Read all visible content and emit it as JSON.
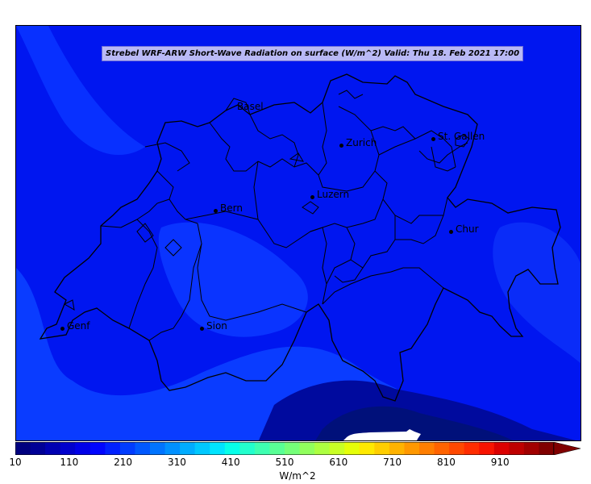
{
  "title": "Strebel WRF-ARW Short-Wave Radiation on surface (W/m^2)   Valid: Thu 18. Feb 2021 17:00",
  "units": "W/m^2",
  "colors": {
    "background_field": "#0016f0",
    "light_field": "#0a3cff",
    "dark_field": "#00108c",
    "border": "#000000",
    "title_bg": "#b9b9f6"
  },
  "cities": [
    {
      "name": "Basel",
      "show_dot": false
    },
    {
      "name": "Zurich",
      "show_dot": true
    },
    {
      "name": "St. Gallen",
      "show_dot": true
    },
    {
      "name": "Bern",
      "show_dot": true
    },
    {
      "name": "Luzern",
      "show_dot": true
    },
    {
      "name": "Chur",
      "show_dot": true
    },
    {
      "name": "Genf",
      "show_dot": true
    },
    {
      "name": "Sion",
      "show_dot": true
    }
  ],
  "colorbar": {
    "min": 10,
    "max": 1010,
    "step": 25,
    "ticks": [
      "10",
      "110",
      "210",
      "310",
      "410",
      "510",
      "610",
      "710",
      "810",
      "910"
    ],
    "extend": "max",
    "colors": [
      "#00007f",
      "#000096",
      "#0000b2",
      "#0000cd",
      "#0000e8",
      "#0005ff",
      "#0020ff",
      "#003cff",
      "#0058ff",
      "#0074ff",
      "#0090ff",
      "#00acff",
      "#00c8ff",
      "#00e4ff",
      "#06ffe9",
      "#22ffcd",
      "#3effb1",
      "#59ff95",
      "#75ff79",
      "#91ff5d",
      "#adff41",
      "#c9ff25",
      "#e5ff09",
      "#ffe900",
      "#ffce00",
      "#ffb300",
      "#ff9800",
      "#ff7e00",
      "#ff6300",
      "#ff4800",
      "#ff2d00",
      "#f81300",
      "#db0000",
      "#be0000",
      "#a10000",
      "#800000"
    ]
  }
}
